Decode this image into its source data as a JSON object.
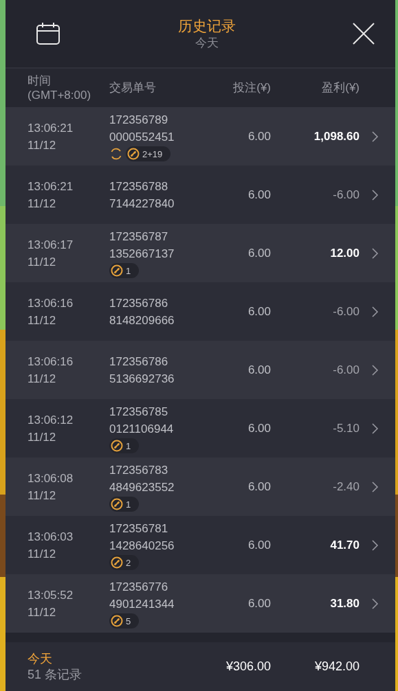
{
  "header": {
    "title": "历史记录",
    "subtitle": "今天"
  },
  "columns": {
    "time": [
      "时间",
      "(GMT+8:00)"
    ],
    "order": "交易单号",
    "bet": "投注(¥)",
    "profit": "盈利(¥)"
  },
  "rows": [
    {
      "time": "13:06:21",
      "date": "11/12",
      "order": [
        "172356789",
        "0000552451"
      ],
      "bet": "6.00",
      "profit": "1,098.60",
      "positive": true,
      "badges": [
        {
          "kind": "refresh"
        },
        {
          "kind": "ball",
          "text": "2+19"
        }
      ]
    },
    {
      "time": "13:06:21",
      "date": "11/12",
      "order": [
        "172356788",
        "7144227840"
      ],
      "bet": "6.00",
      "profit": "-6.00",
      "positive": false,
      "badges": []
    },
    {
      "time": "13:06:17",
      "date": "11/12",
      "order": [
        "172356787",
        "1352667137"
      ],
      "bet": "6.00",
      "profit": "12.00",
      "positive": true,
      "badges": [
        {
          "kind": "ball",
          "text": "1"
        }
      ]
    },
    {
      "time": "13:06:16",
      "date": "11/12",
      "order": [
        "172356786",
        "8148209666"
      ],
      "bet": "6.00",
      "profit": "-6.00",
      "positive": false,
      "badges": []
    },
    {
      "time": "13:06:16",
      "date": "11/12",
      "order": [
        "172356786",
        "5136692736"
      ],
      "bet": "6.00",
      "profit": "-6.00",
      "positive": false,
      "badges": []
    },
    {
      "time": "13:06:12",
      "date": "11/12",
      "order": [
        "172356785",
        "0121106944"
      ],
      "bet": "6.00",
      "profit": "-5.10",
      "positive": false,
      "badges": [
        {
          "kind": "ball",
          "text": "1"
        }
      ]
    },
    {
      "time": "13:06:08",
      "date": "11/12",
      "order": [
        "172356783",
        "4849623552"
      ],
      "bet": "6.00",
      "profit": "-2.40",
      "positive": false,
      "badges": [
        {
          "kind": "ball",
          "text": "1"
        }
      ]
    },
    {
      "time": "13:06:03",
      "date": "11/12",
      "order": [
        "172356781",
        "1428640256"
      ],
      "bet": "6.00",
      "profit": "41.70",
      "positive": true,
      "badges": [
        {
          "kind": "ball",
          "text": "2"
        }
      ]
    },
    {
      "time": "13:05:52",
      "date": "11/12",
      "order": [
        "172356776",
        "4901241344"
      ],
      "bet": "6.00",
      "profit": "31.80",
      "positive": true,
      "badges": [
        {
          "kind": "ball",
          "text": "5"
        }
      ]
    }
  ],
  "footer": {
    "period": "今天",
    "count": "51 条记录",
    "bet_total": "¥306.00",
    "profit_total": "¥942.00"
  }
}
